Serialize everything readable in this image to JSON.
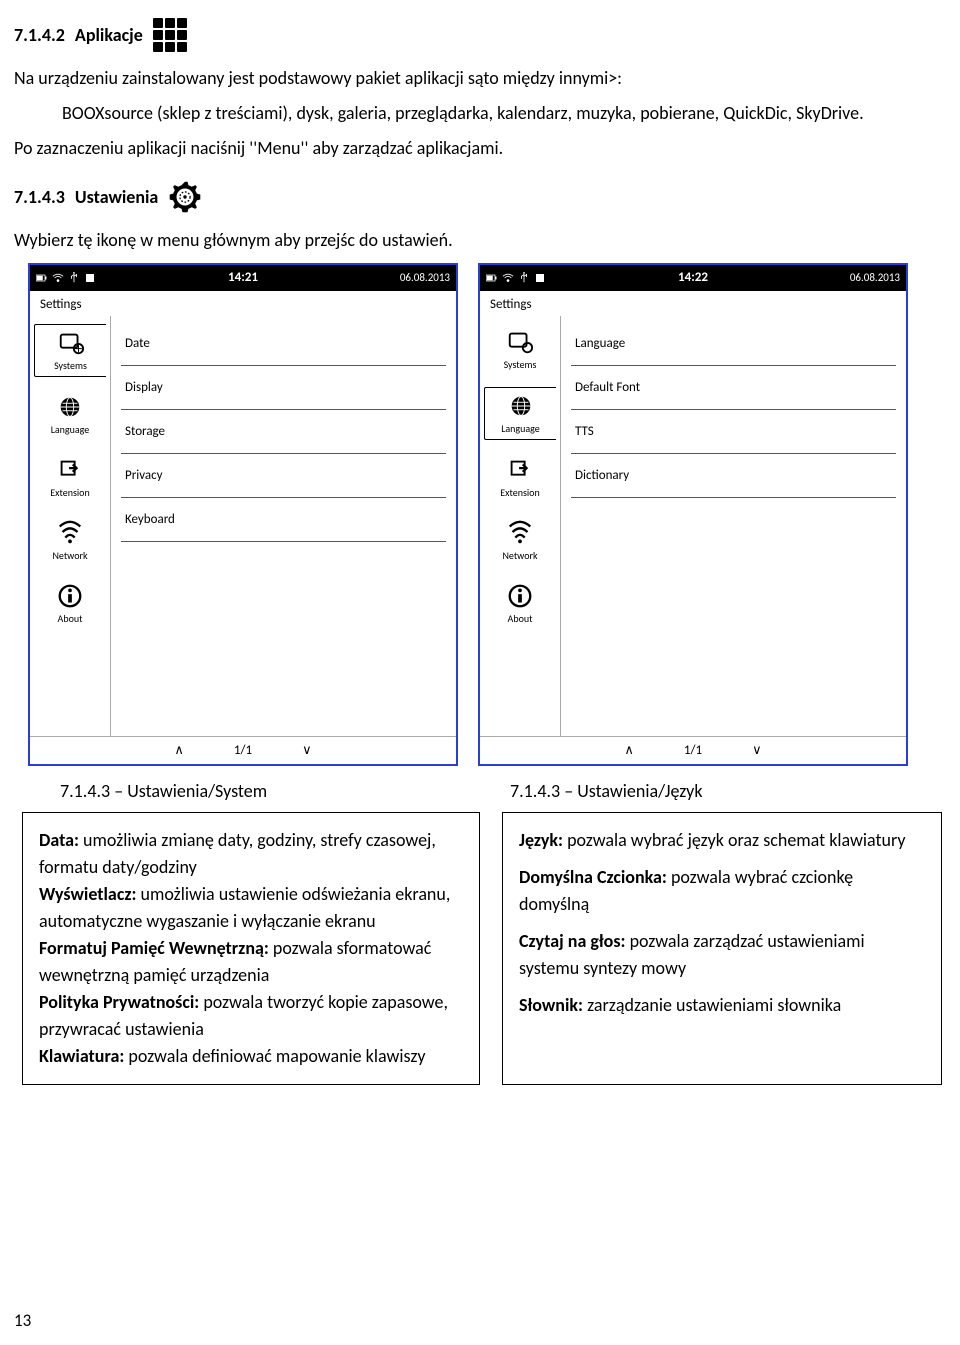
{
  "section_apps": {
    "number": "7.1.4.2",
    "title": "Aplikacje",
    "intro": "Na urządzeniu zainstalowany jest podstawowy pakiet aplikacji sąto między innymi>:",
    "list": "BOOXsource (sklep z treściami), dysk, galeria,  przeglądarka, kalendarz, muzyka, pobierane, QuickDic, SkyDrive.",
    "note": "Po zaznaczeniu aplikacji naciśnij ''Menu'' aby zarządzać aplikacjami."
  },
  "section_settings": {
    "number": "7.1.4.3",
    "title": "Ustawienia",
    "desc": "Wybierz tę ikonę w menu głównym aby przejśc do ustawień."
  },
  "screen1": {
    "time": "14:21",
    "date": "06.08.2013",
    "header": "Settings",
    "tabs": [
      "Systems",
      "Language",
      "Extension",
      "Network",
      "About"
    ],
    "items": [
      "Date",
      "Display",
      "Storage",
      "Privacy",
      "Keyboard"
    ],
    "pager": "1/1"
  },
  "screen2": {
    "time": "14:22",
    "date": "06.08.2013",
    "header": "Settings",
    "tabs": [
      "Systems",
      "Language",
      "Extension",
      "Network",
      "About"
    ],
    "items": [
      "Language",
      "Default Font",
      "TTS",
      "Dictionary"
    ],
    "pager": "1/1"
  },
  "captions": {
    "left": "7.1.4.3 – Ustawienia/System",
    "right": "7.1.4.3 – Ustawienia/Język"
  },
  "box_left": {
    "data_label": "Data:",
    "data_text": " umożliwia zmianę daty, godziny, strefy czasowej, formatu daty/godziny",
    "display_label": "Wyświetlacz:",
    "display_text": " umożliwia ustawienie odświeżania ekranu, automatyczne wygaszanie i wyłączanie ekranu",
    "format_label": "Formatuj Pamięć Wewnętrzną:",
    "format_text": " pozwala sformatować wewnętrzną pamięć urządzenia",
    "privacy_label": "Polityka Prywatności:",
    "privacy_text": " pozwala tworzyć kopie zapasowe, przywracać ustawienia",
    "keyboard_label": "Klawiatura:",
    "keyboard_text": " pozwala definiować mapowanie klawiszy"
  },
  "box_right": {
    "lang_label": "Język:",
    "lang_text": " pozwala wybrać język oraz schemat klawiatury",
    "font_label": "Domyślna Czcionka:",
    "font_text": " pozwala wybrać czcionkę domyślną",
    "tts_label": "Czytaj na głos:",
    "tts_text": " pozwala zarządzać ustawieniami systemu syntezy mowy",
    "dict_label": "Słownik:",
    "dict_text": "  zarządzanie ustawieniami słownika"
  },
  "page_number": "13"
}
